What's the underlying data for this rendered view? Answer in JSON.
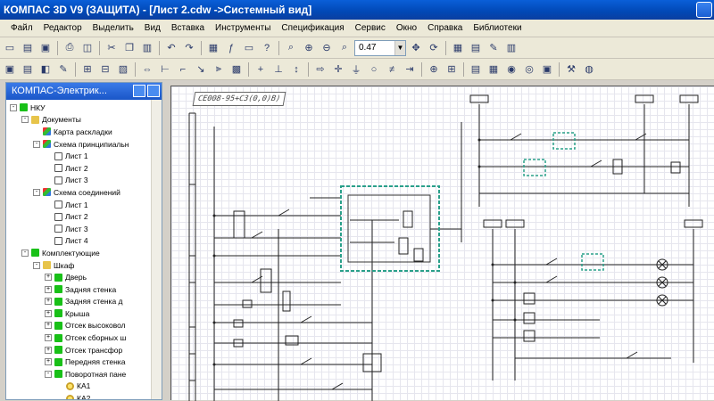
{
  "window": {
    "title": "КОМПАС 3D V9 (ЗАЩИТА) - [Лист 2.cdw ->Системный вид]"
  },
  "menu": [
    "Файл",
    "Редактор",
    "Выделить",
    "Вид",
    "Вставка",
    "Инструменты",
    "Спецификация",
    "Сервис",
    "Окно",
    "Справка",
    "Библиотеки"
  ],
  "toolbar": {
    "zoom_value": "0.47"
  },
  "panel": {
    "title": "КОМПАС-Электрик..."
  },
  "tree": [
    {
      "level": 0,
      "toggle": "-",
      "icon": "green",
      "label": "НКУ"
    },
    {
      "level": 1,
      "toggle": "-",
      "icon": "folder",
      "label": "Документы"
    },
    {
      "level": 2,
      "toggle": "",
      "icon": "multi",
      "label": "Карта раскладки"
    },
    {
      "level": 2,
      "toggle": "-",
      "icon": "multi",
      "label": "Схема принципиальн"
    },
    {
      "level": 3,
      "toggle": "",
      "icon": "doc",
      "label": "Лист 1"
    },
    {
      "level": 3,
      "toggle": "",
      "icon": "doc",
      "label": "Лист 2"
    },
    {
      "level": 3,
      "toggle": "",
      "icon": "doc",
      "label": "Лист 3"
    },
    {
      "level": 2,
      "toggle": "-",
      "icon": "multi",
      "label": "Схема соединений"
    },
    {
      "level": 3,
      "toggle": "",
      "icon": "doc",
      "label": "Лист 1"
    },
    {
      "level": 3,
      "toggle": "",
      "icon": "doc",
      "label": "Лист 2"
    },
    {
      "level": 3,
      "toggle": "",
      "icon": "doc",
      "label": "Лист 3"
    },
    {
      "level": 3,
      "toggle": "",
      "icon": "doc",
      "label": "Лист 4"
    },
    {
      "level": 1,
      "toggle": "-",
      "icon": "green",
      "label": "Комплектующие"
    },
    {
      "level": 2,
      "toggle": "-",
      "icon": "folder",
      "label": "Шкаф"
    },
    {
      "level": 3,
      "toggle": "+",
      "icon": "green",
      "label": "Дверь"
    },
    {
      "level": 3,
      "toggle": "+",
      "icon": "green",
      "label": "Задняя стенка"
    },
    {
      "level": 3,
      "toggle": "+",
      "icon": "green",
      "label": "Задняя стенка д"
    },
    {
      "level": 3,
      "toggle": "+",
      "icon": "green",
      "label": "Крыша"
    },
    {
      "level": 3,
      "toggle": "+",
      "icon": "green",
      "label": "Отсек высоковол"
    },
    {
      "level": 3,
      "toggle": "+",
      "icon": "green",
      "label": "Отсек сборных ш"
    },
    {
      "level": 3,
      "toggle": "+",
      "icon": "green",
      "label": "Отсек трансфор"
    },
    {
      "level": 3,
      "toggle": "+",
      "icon": "green",
      "label": "Передняя стенка"
    },
    {
      "level": 3,
      "toggle": "-",
      "icon": "green",
      "label": "Поворотная пане"
    },
    {
      "level": 4,
      "toggle": "",
      "icon": "bulb",
      "label": "КА1"
    },
    {
      "level": 4,
      "toggle": "",
      "icon": "bulb",
      "label": "КА2"
    }
  ],
  "sheet": {
    "stamp": "СЕ008-95+СЗ(0,0)В)"
  },
  "colors": {
    "accent_title": "#0a4fc8",
    "highlight_box": "#2aa08a"
  }
}
